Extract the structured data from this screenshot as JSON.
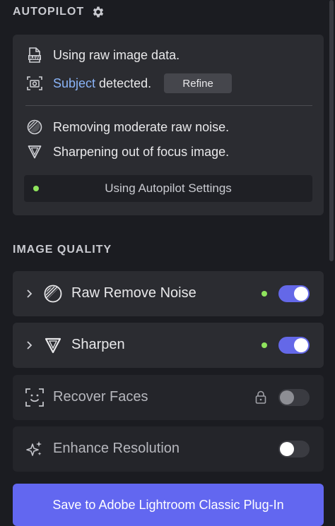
{
  "autopilot": {
    "title": "AUTOPILOT",
    "icons": [
      "gear-icon",
      "raw-file-icon",
      "subject-camera-icon",
      "noise-icon",
      "sharpen-icon"
    ],
    "raw_text": "Using raw image data.",
    "subject_link": "Subject",
    "subject_text": "detected.",
    "refine_label": "Refine",
    "noise_text": "Removing moderate raw noise.",
    "sharpen_text": "Sharpening out of focus image.",
    "settings_label": "Using Autopilot Settings"
  },
  "image_quality": {
    "title": "IMAGE QUALITY",
    "tools": [
      {
        "label": "Raw Remove Noise",
        "icon": "noise-icon",
        "enabled": true,
        "status": "active"
      },
      {
        "label": "Sharpen",
        "icon": "sharpen-icon",
        "enabled": true,
        "status": "active"
      },
      {
        "label": "Recover Faces",
        "icon": "face-scan-icon",
        "enabled": false,
        "locked": true
      },
      {
        "label": "Enhance Resolution",
        "icon": "sparkle-icon",
        "enabled": false
      }
    ]
  },
  "footer": {
    "save_label": "Save to Adobe Lightroom Classic Plug-In"
  },
  "colors": {
    "accent": "#6267f0",
    "status_green": "#8fe45d",
    "link": "#8ab4f8",
    "panel": "#2b2c31",
    "background": "#1b1c21"
  }
}
